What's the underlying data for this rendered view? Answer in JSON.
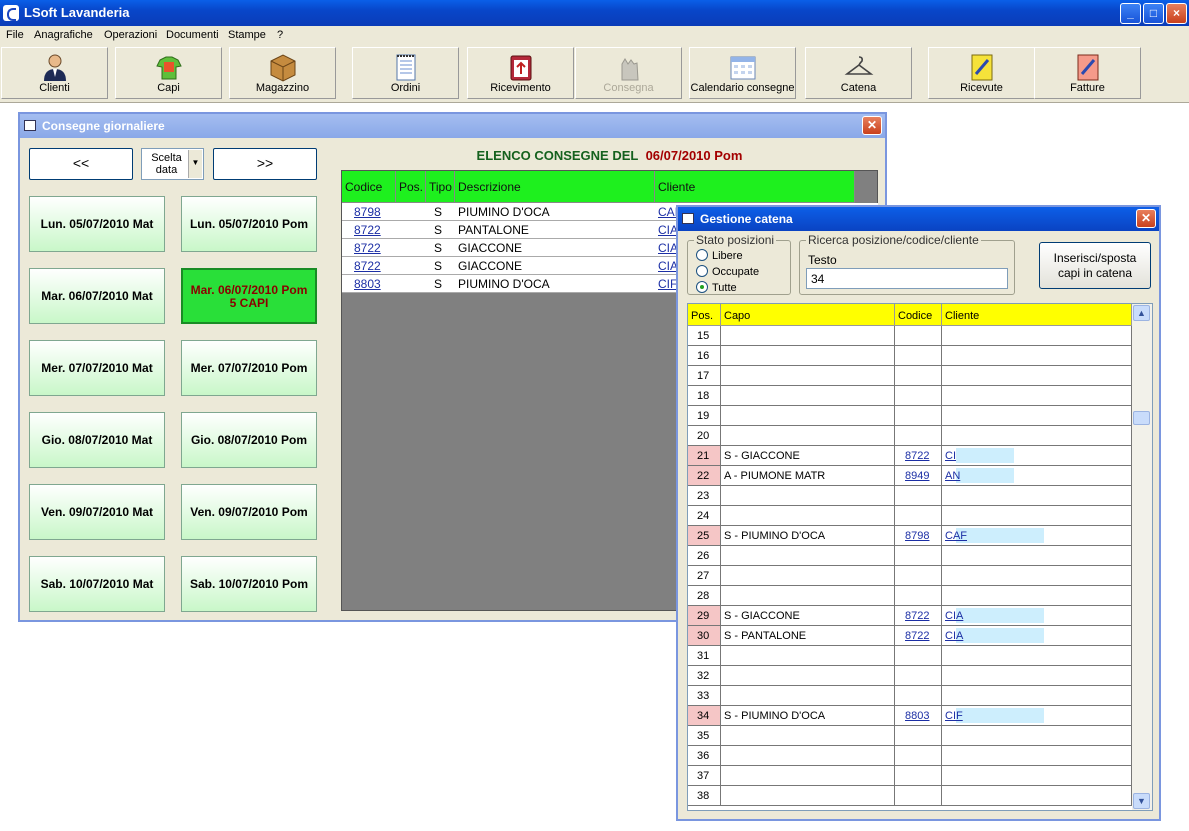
{
  "app": {
    "title": "LSoft Lavanderia"
  },
  "window_buttons": {
    "minimize": "_",
    "maximize": "□",
    "close": "×"
  },
  "menu": [
    "File",
    "Anagrafiche",
    "Operazioni",
    "Documenti",
    "Stampe",
    "?"
  ],
  "toolbar": [
    {
      "label": "Clienti",
      "icon": "user-icon",
      "enabled": true
    },
    {
      "label": "Capi",
      "icon": "shirt-icon",
      "enabled": true
    },
    {
      "label": "Magazzino",
      "icon": "box-icon",
      "enabled": true
    },
    {
      "label": "Ordini",
      "icon": "notepad-icon",
      "enabled": true
    },
    {
      "label": "Ricevimento",
      "icon": "clipboard-icon",
      "enabled": true
    },
    {
      "label": "Consegna",
      "icon": "hand-icon",
      "enabled": false
    },
    {
      "label": "Calendario consegne",
      "icon": "calendar-icon",
      "enabled": true
    },
    {
      "label": "Catena",
      "icon": "hanger-icon",
      "enabled": true
    },
    {
      "label": "Ricevute",
      "icon": "receipt-icon",
      "enabled": true
    },
    {
      "label": "Fatture",
      "icon": "invoice-icon",
      "enabled": true
    }
  ],
  "consegne": {
    "title": "Consegne giornaliere",
    "prev": "<<",
    "next": ">>",
    "scelta_line1": "Scelta",
    "scelta_line2": "data",
    "days": [
      {
        "label": "Lun. 05/07/2010 Mat",
        "sub": ""
      },
      {
        "label": "Lun. 05/07/2010 Pom",
        "sub": ""
      },
      {
        "label": "Mar. 06/07/2010 Mat",
        "sub": ""
      },
      {
        "label": "Mar. 06/07/2010 Pom",
        "sub": "5 CAPI"
      },
      {
        "label": "Mer. 07/07/2010 Mat",
        "sub": ""
      },
      {
        "label": "Mer. 07/07/2010 Pom",
        "sub": ""
      },
      {
        "label": "Gio. 08/07/2010 Mat",
        "sub": ""
      },
      {
        "label": "Gio. 08/07/2010 Pom",
        "sub": ""
      },
      {
        "label": "Ven. 09/07/2010 Mat",
        "sub": ""
      },
      {
        "label": "Ven. 09/07/2010 Pom",
        "sub": ""
      },
      {
        "label": "Sab. 10/07/2010 Mat",
        "sub": ""
      },
      {
        "label": "Sab. 10/07/2010 Pom",
        "sub": ""
      }
    ],
    "elenco_label": "ELENCO CONSEGNE DEL",
    "elenco_date": "06/07/2010 Pom",
    "columns": [
      "Codice",
      "Pos.",
      "Tipo",
      "Descrizione",
      "Cliente"
    ],
    "rows": [
      {
        "codice": "8798",
        "pos": "",
        "tipo": "S",
        "descrizione": "PIUMINO D'OCA",
        "cliente": "CAI"
      },
      {
        "codice": "8722",
        "pos": "",
        "tipo": "S",
        "descrizione": "PANTALONE",
        "cliente": "CIA"
      },
      {
        "codice": "8722",
        "pos": "",
        "tipo": "S",
        "descrizione": "GIACCONE",
        "cliente": "CIA"
      },
      {
        "codice": "8722",
        "pos": "",
        "tipo": "S",
        "descrizione": "GIACCONE",
        "cliente": "CIA"
      },
      {
        "codice": "8803",
        "pos": "",
        "tipo": "S",
        "descrizione": "PIUMINO D'OCA",
        "cliente": "CIF"
      }
    ]
  },
  "catena": {
    "title": "Gestione catena",
    "stato_label": "Stato posizioni",
    "radios": [
      {
        "label": "Libere",
        "checked": false
      },
      {
        "label": "Occupate",
        "checked": false
      },
      {
        "label": "Tutte",
        "checked": true
      }
    ],
    "ricerca_label": "Ricerca posizione/codice/cliente",
    "testo_label": "Testo",
    "testo_value": "34",
    "insert_line1": "Inserisci/sposta",
    "insert_line2": "capi in catena",
    "columns": [
      "Pos.",
      "Capo",
      "Codice",
      "Cliente"
    ],
    "rows": [
      {
        "pos": "15",
        "capo": "",
        "codice": "",
        "cliente": ""
      },
      {
        "pos": "16",
        "capo": "",
        "codice": "",
        "cliente": ""
      },
      {
        "pos": "17",
        "capo": "",
        "codice": "",
        "cliente": ""
      },
      {
        "pos": "18",
        "capo": "",
        "codice": "",
        "cliente": ""
      },
      {
        "pos": "19",
        "capo": "",
        "codice": "",
        "cliente": ""
      },
      {
        "pos": "20",
        "capo": "",
        "codice": "",
        "cliente": ""
      },
      {
        "pos": "21",
        "capo": "S - GIACCONE",
        "codice": "8722",
        "cliente": "CI"
      },
      {
        "pos": "22",
        "capo": "A - PIUMONE MATR",
        "codice": "8949",
        "cliente": "AN"
      },
      {
        "pos": "23",
        "capo": "",
        "codice": "",
        "cliente": ""
      },
      {
        "pos": "24",
        "capo": "",
        "codice": "",
        "cliente": ""
      },
      {
        "pos": "25",
        "capo": "S - PIUMINO D'OCA",
        "codice": "8798",
        "cliente": "CAF"
      },
      {
        "pos": "26",
        "capo": "",
        "codice": "",
        "cliente": ""
      },
      {
        "pos": "27",
        "capo": "",
        "codice": "",
        "cliente": ""
      },
      {
        "pos": "28",
        "capo": "",
        "codice": "",
        "cliente": ""
      },
      {
        "pos": "29",
        "capo": "S - GIACCONE",
        "codice": "8722",
        "cliente": "CIA"
      },
      {
        "pos": "30",
        "capo": "S - PANTALONE",
        "codice": "8722",
        "cliente": "CIA"
      },
      {
        "pos": "31",
        "capo": "",
        "codice": "",
        "cliente": ""
      },
      {
        "pos": "32",
        "capo": "",
        "codice": "",
        "cliente": ""
      },
      {
        "pos": "33",
        "capo": "",
        "codice": "",
        "cliente": ""
      },
      {
        "pos": "34",
        "capo": "S - PIUMINO D'OCA",
        "codice": "8803",
        "cliente": "CIF"
      },
      {
        "pos": "35",
        "capo": "",
        "codice": "",
        "cliente": ""
      },
      {
        "pos": "36",
        "capo": "",
        "codice": "",
        "cliente": ""
      },
      {
        "pos": "37",
        "capo": "",
        "codice": "",
        "cliente": ""
      },
      {
        "pos": "38",
        "capo": "",
        "codice": "",
        "cliente": ""
      }
    ],
    "scroll_up": "▲",
    "scroll_down": "▼"
  }
}
